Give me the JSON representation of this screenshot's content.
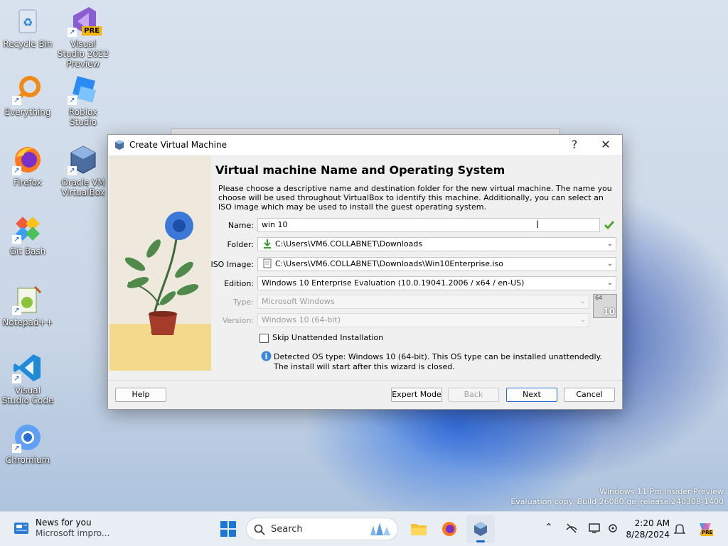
{
  "desktop": {
    "icons": [
      {
        "label": "Recycle Bin"
      },
      {
        "label": "Visual Studio 2022 Preview",
        "badge": "PRE"
      },
      {
        "label": "Everything"
      },
      {
        "label": "Roblox Studio"
      },
      {
        "label": "Firefox"
      },
      {
        "label": "Oracle VM VirtualBox"
      },
      {
        "label": "Git Bash"
      },
      {
        "label": "Notepad++"
      },
      {
        "label": "Visual Studio Code"
      },
      {
        "label": "Chromium"
      }
    ]
  },
  "dialog": {
    "title": "Create Virtual Machine",
    "help_glyph": "?",
    "close_glyph": "✕",
    "heading": "Virtual machine Name and Operating System",
    "description": "Please choose a descriptive name and destination folder for the new virtual machine. The name you choose will be used throughout VirtualBox to identify this machine. Additionally, you can select an ISO image which may be used to install the guest operating system.",
    "name_label": "Name:",
    "name_value": "win 10",
    "folder_label": "Folder:",
    "folder_value": "C:\\Users\\VM6.COLLABNET\\Downloads",
    "iso_label": "ISO Image:",
    "iso_value": "C:\\Users\\VM6.COLLABNET\\Downloads\\Win10Enterprise.iso",
    "edition_label": "Edition:",
    "edition_value": "Windows 10 Enterprise Evaluation (10.0.19041.2006 / x64 / en-US)",
    "type_label": "Type:",
    "type_value": "Microsoft Windows",
    "version_label": "Version:",
    "version_value": "Windows 10 (64-bit)",
    "os_badge_top": "64",
    "os_badge_bottom": "10",
    "skip_label": "Skip Unattended Installation",
    "skip_checked": false,
    "info_text": "Detected OS type: Windows 10 (64-bit). This OS type can be installed unattendedly. The install will start after this wizard is closed.",
    "buttons": {
      "help": "Help",
      "expert": "Expert Mode",
      "back": "Back",
      "next": "Next",
      "cancel": "Cancel"
    }
  },
  "watermark": {
    "line1": "Windows 11 Pro Insider Preview",
    "line2": "Evaluation copy. Build 26080.ge_release.240308-1400"
  },
  "taskbar": {
    "news_title": "News for you",
    "news_sub": "Microsoft impro...",
    "search_label": "Search",
    "time": "2:20 AM",
    "date": "8/28/2024",
    "copilot_badge": "PRE"
  }
}
